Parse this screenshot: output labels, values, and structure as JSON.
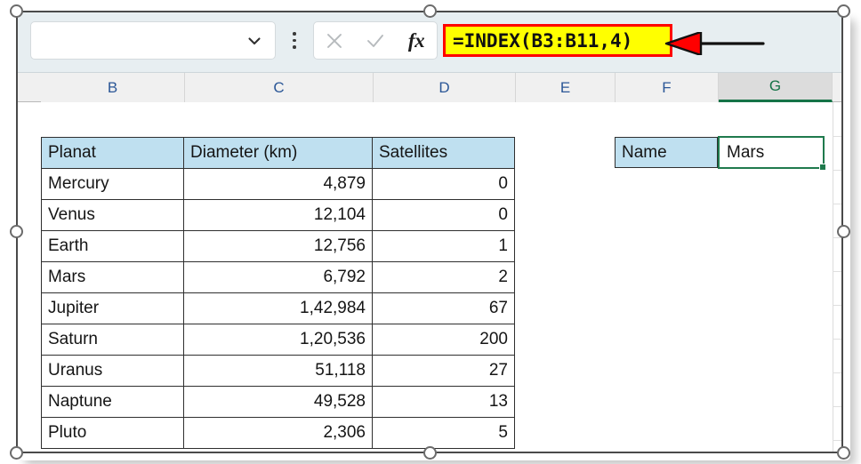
{
  "app": {
    "name_box_value": "",
    "name_box_placeholder": "",
    "dropdown_icon": "chevron-down-icon",
    "more_options_icon": "kebab-menu-icon",
    "cancel_icon": "close-x-icon",
    "confirm_icon": "checkmark-icon",
    "function_icon": "fx-insert-function-icon",
    "formula": "=INDEX(B3:B11,4)",
    "annotation_arrow": "red-arrow-pointing-left"
  },
  "colors": {
    "formula_highlight_bg": "#ffff00",
    "formula_highlight_border": "#ff0000",
    "table_header_bg": "#bfe0f0",
    "selection_border": "#1f7a4d",
    "column_header_text": "#2b5797",
    "selected_column_text": "#157347",
    "annotation_red": "#ff0000"
  },
  "columns": [
    {
      "label": "B",
      "selected": false
    },
    {
      "label": "C",
      "selected": false
    },
    {
      "label": "D",
      "selected": false
    },
    {
      "label": "E",
      "selected": false
    },
    {
      "label": "F",
      "selected": false
    },
    {
      "label": "G",
      "selected": true
    }
  ],
  "table": {
    "headers": [
      "Planat",
      "Diameter (km)",
      "Satellites"
    ],
    "rows": [
      {
        "planet": "Mercury",
        "diameter": "4,879",
        "satellites": "0"
      },
      {
        "planet": "Venus",
        "diameter": "12,104",
        "satellites": "0"
      },
      {
        "planet": "Earth",
        "diameter": "12,756",
        "satellites": "1"
      },
      {
        "planet": "Mars",
        "diameter": "6,792",
        "satellites": "2"
      },
      {
        "planet": "Jupiter",
        "diameter": "1,42,984",
        "satellites": "67"
      },
      {
        "planet": "Saturn",
        "diameter": "1,20,536",
        "satellites": "200"
      },
      {
        "planet": "Uranus",
        "diameter": "51,118",
        "satellites": "27"
      },
      {
        "planet": "Naptune",
        "diameter": "49,528",
        "satellites": "13"
      },
      {
        "planet": "Pluto",
        "diameter": "2,306",
        "satellites": "5"
      }
    ]
  },
  "result": {
    "label": "Name",
    "value": "Mars"
  }
}
